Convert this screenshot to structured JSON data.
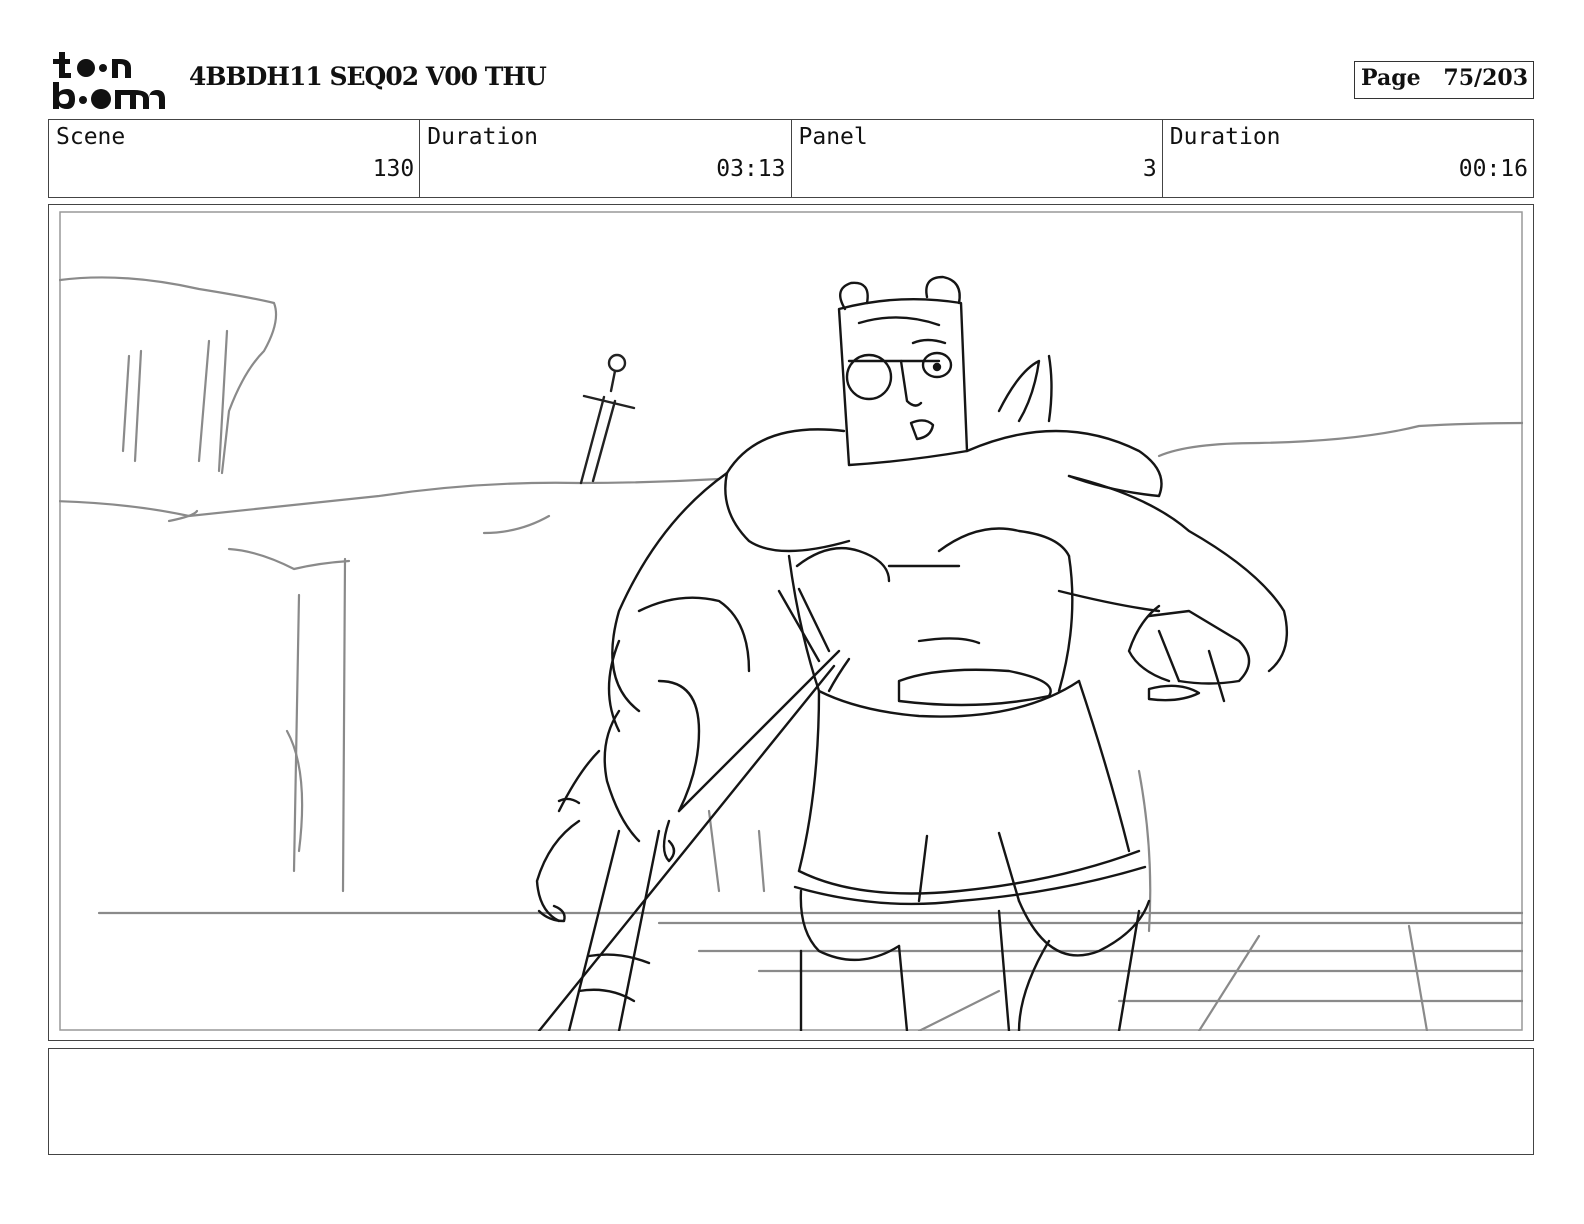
{
  "header": {
    "title": "4BBDH11 SEQ02 V00 THU",
    "page_label": "Page",
    "page_number": "75/203"
  },
  "logo": {
    "top_text": "toon",
    "bottom_text": "boom"
  },
  "info": {
    "scene_label": "Scene",
    "scene_value": "130",
    "scene_duration_label": "Duration",
    "scene_duration_value": "03:13",
    "panel_label": "Panel",
    "panel_value": "3",
    "panel_duration_label": "Duration",
    "panel_duration_value": "00:16"
  },
  "notes": {
    "text": ""
  }
}
